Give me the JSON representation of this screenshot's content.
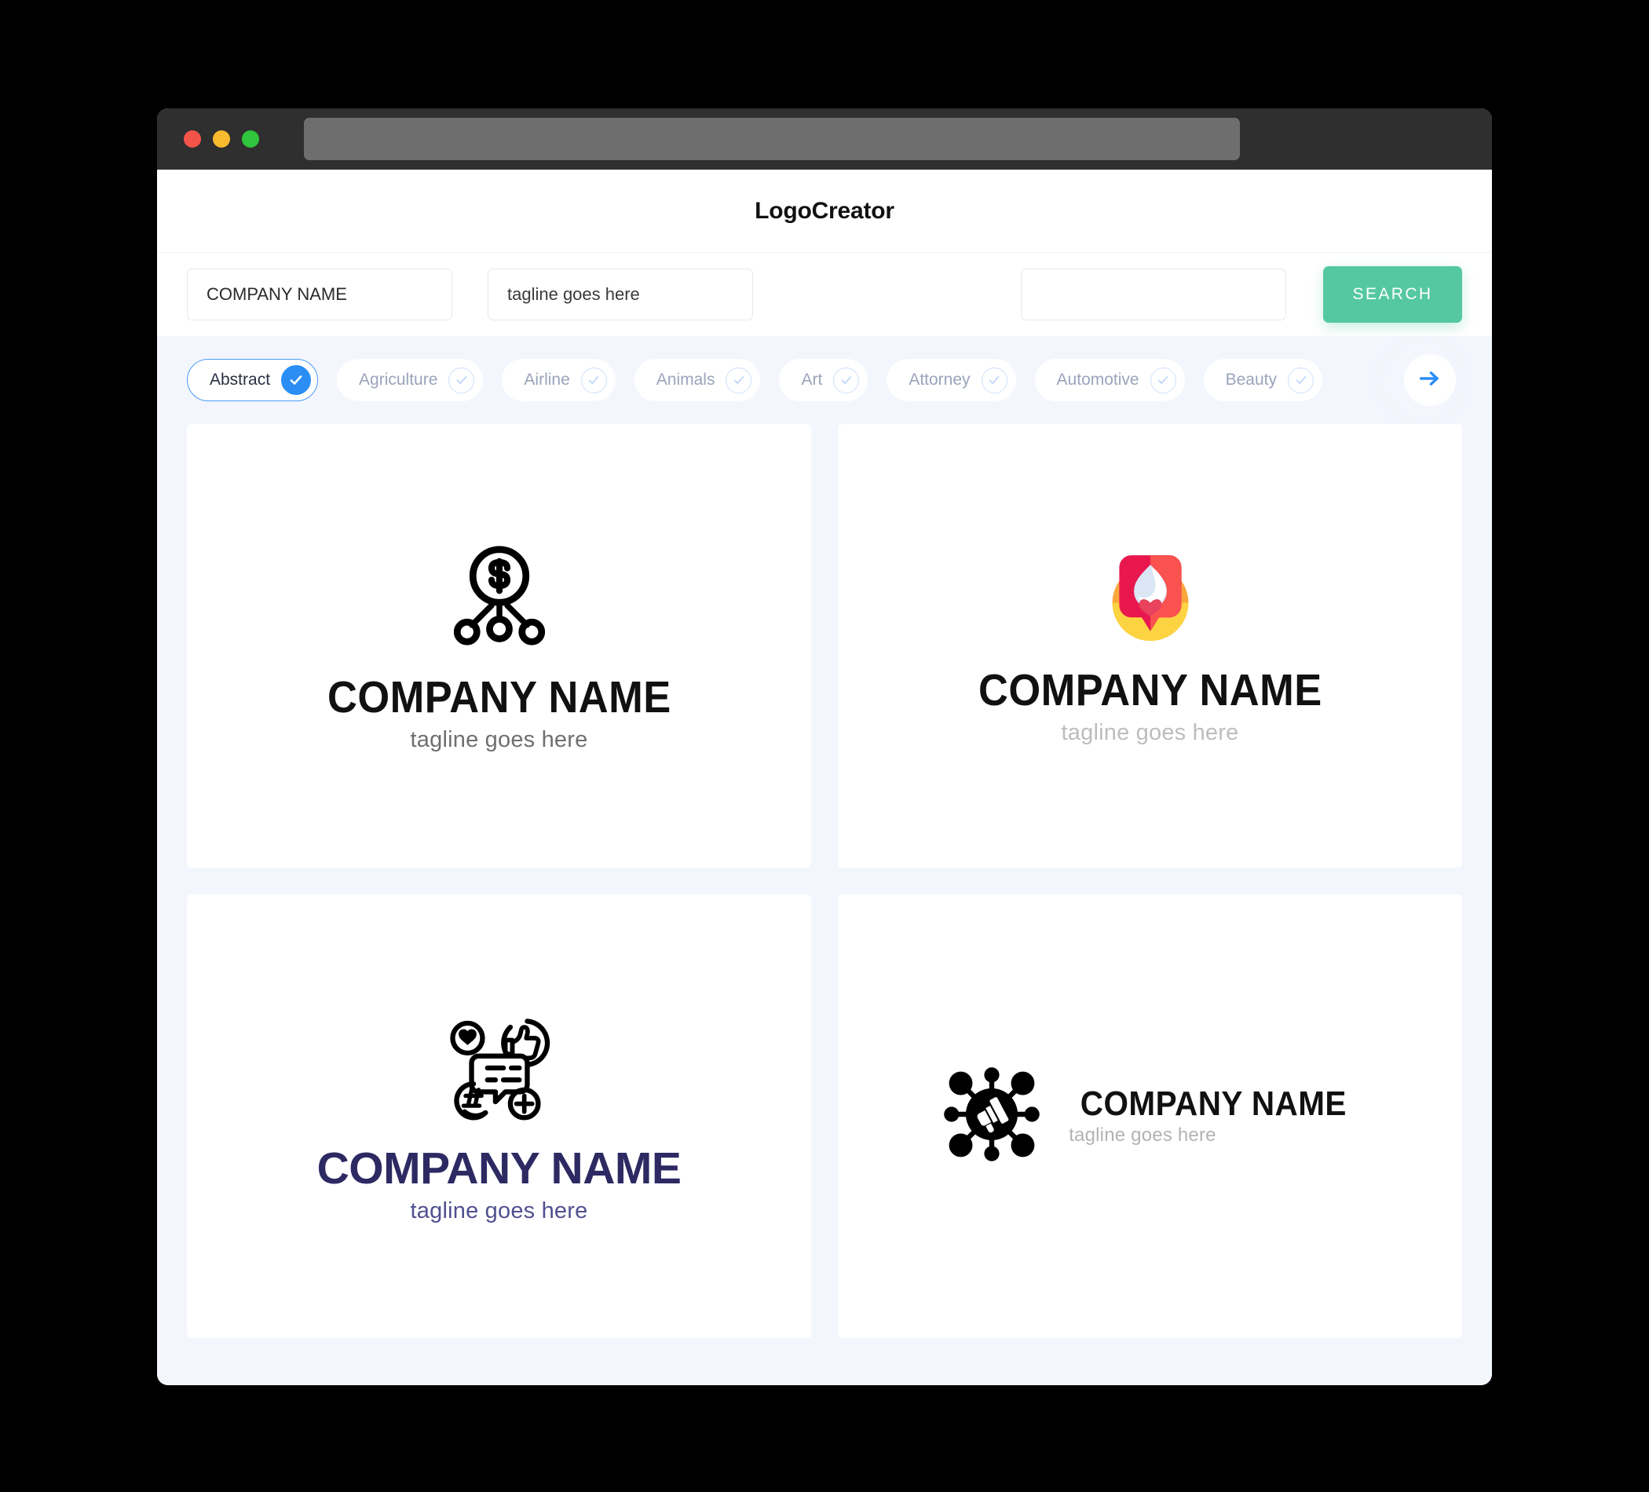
{
  "window": {
    "traffic_lights": [
      "close-red",
      "minimize-yellow",
      "maximize-green"
    ],
    "url_bar_value": ""
  },
  "app": {
    "title": "LogoCreator"
  },
  "search": {
    "company_name_value": "COMPANY NAME",
    "company_name_placeholder": "COMPANY NAME",
    "tagline_value": "tagline goes here",
    "tagline_placeholder": "tagline goes here",
    "keyword_value": "",
    "keyword_placeholder": "",
    "search_button_label": "SEARCH",
    "search_button_color": "#55c8a2"
  },
  "categories": {
    "selected": "Abstract",
    "accent_color": "#2b8ef5",
    "next_arrow_icon": "arrow-right-icon",
    "items": [
      {
        "label": "Abstract",
        "selected": true
      },
      {
        "label": "Agriculture",
        "selected": false
      },
      {
        "label": "Airline",
        "selected": false
      },
      {
        "label": "Animals",
        "selected": false
      },
      {
        "label": "Art",
        "selected": false
      },
      {
        "label": "Attorney",
        "selected": false
      },
      {
        "label": "Automotive",
        "selected": false
      },
      {
        "label": "Beauty",
        "selected": false
      }
    ]
  },
  "logos": [
    {
      "id": "logo-dollar-network",
      "icon": "dollar-circle-network-icon",
      "name": "COMPANY NAME",
      "tagline": "tagline goes here",
      "name_color": "#111111",
      "tagline_color": "#6f6f6f",
      "layout": "stacked"
    },
    {
      "id": "logo-flame-heart-badge",
      "icon": "flame-heart-badge-icon",
      "name": "COMPANY NAME",
      "tagline": "tagline goes here",
      "name_color": "#111111",
      "tagline_color": "#bdbdbd",
      "layout": "stacked",
      "icon_colors": {
        "circle_yellow": "#fcd341",
        "circle_orange": "#f9a73b",
        "badge_pink": "#e8174e",
        "badge_red": "#f9524f",
        "flame_white": "#ffffff",
        "flame_shadow": "#dbe6f5",
        "heart_red": "#e8425c"
      }
    },
    {
      "id": "logo-social-cluster",
      "icon": "social-media-cluster-icon",
      "name": "COMPANY NAME",
      "tagline": "tagline goes here",
      "name_color": "#2d2a63",
      "tagline_color": "#51508f",
      "layout": "stacked"
    },
    {
      "id": "logo-megaphone-network",
      "icon": "megaphone-network-icon",
      "name": "COMPANY NAME",
      "tagline": "tagline goes here",
      "name_color": "#111111",
      "tagline_color": "#b3b3b3",
      "layout": "horizontal"
    }
  ]
}
